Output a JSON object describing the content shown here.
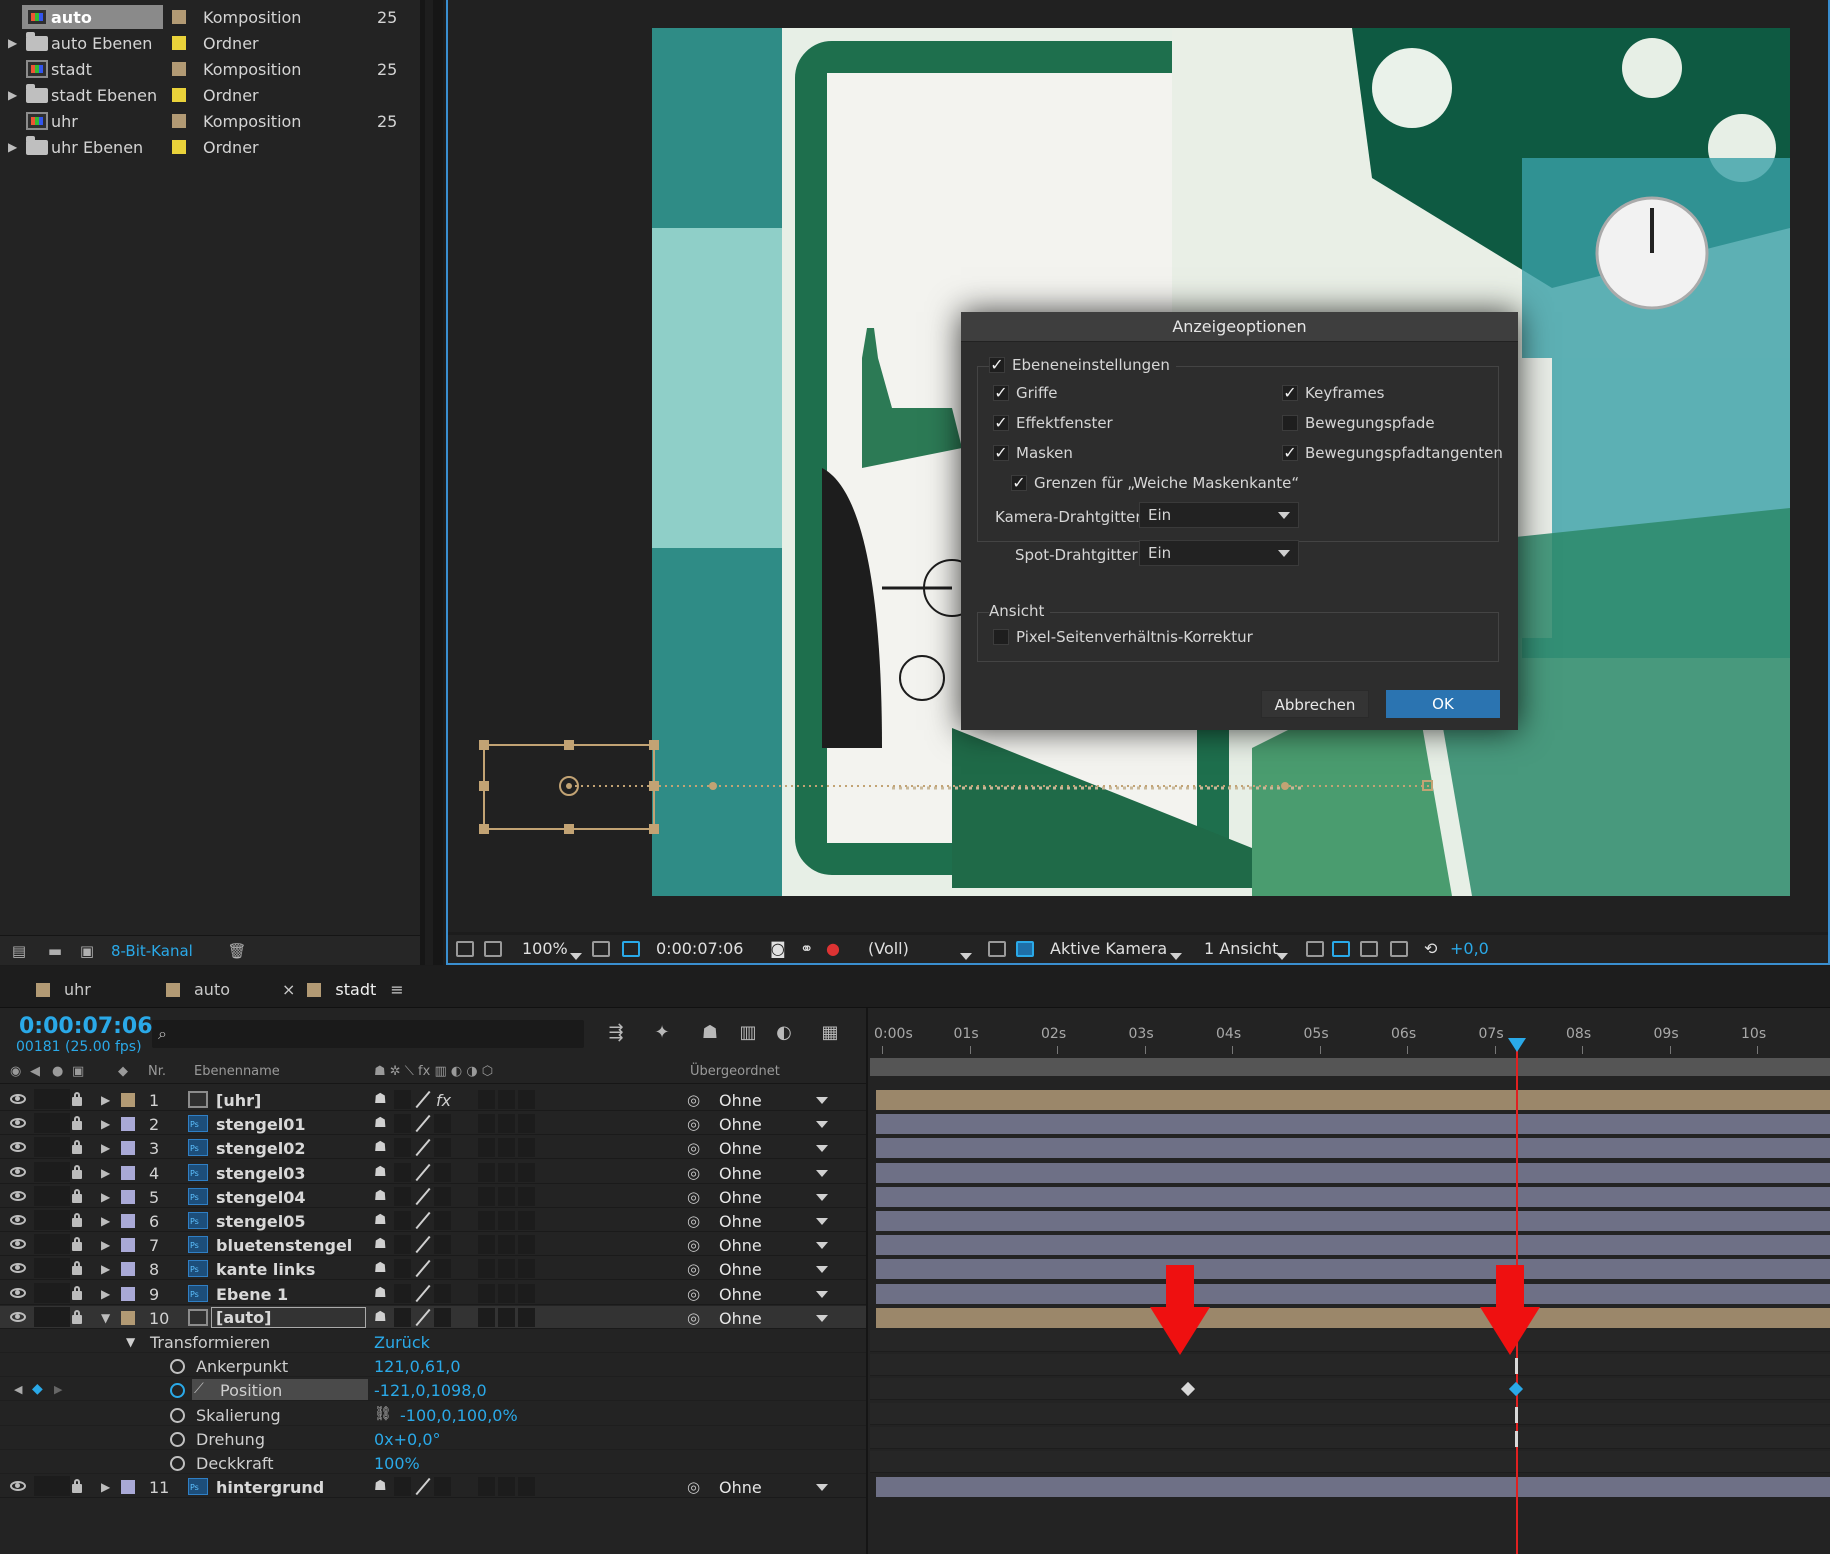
{
  "project": {
    "items": [
      {
        "name": "auto",
        "label_color": "#b29a74",
        "type": "Komposition",
        "frames": "25",
        "kind": "comp",
        "twirl": "",
        "selected": true
      },
      {
        "name": "auto Ebenen",
        "label_color": "#e9d23a",
        "type": "Ordner",
        "frames": "",
        "kind": "folder",
        "twirl": "▶"
      },
      {
        "name": "stadt",
        "label_color": "#b29a74",
        "type": "Komposition",
        "frames": "25",
        "kind": "comp",
        "twirl": ""
      },
      {
        "name": "stadt Ebenen",
        "label_color": "#e9d23a",
        "type": "Ordner",
        "frames": "",
        "kind": "folder",
        "twirl": "▶"
      },
      {
        "name": "uhr",
        "label_color": "#b29a74",
        "type": "Komposition",
        "frames": "25",
        "kind": "comp",
        "twirl": ""
      },
      {
        "name": "uhr Ebenen",
        "label_color": "#e9d23a",
        "type": "Ordner",
        "frames": "",
        "kind": "folder",
        "twirl": "▶"
      }
    ],
    "bit_depth": "8-Bit-Kanal"
  },
  "viewer": {
    "zoom": "100%",
    "timecode": "0:00:07:06",
    "resolution": "(Voll)",
    "camera": "Aktive Kamera",
    "views": "1 Ansicht",
    "exposure": "+0,0"
  },
  "dialog": {
    "title": "Anzeigeoptionen",
    "group1_label": "Ebeneneinstellungen",
    "griffe": "Griffe",
    "effektfenster": "Effektfenster",
    "masken": "Masken",
    "grenzen": "Grenzen für „Weiche Maskenkante“",
    "keyframes": "Keyframes",
    "bewegungspfade": "Bewegungspfade",
    "bewegungspfadtangenten": "Bewegungspfadtangenten",
    "kamera_label": "Kamera-Drahtgitter:",
    "kamera_value": "Ein",
    "spot_label": "Spot-Drahtgitter:",
    "spot_value": "Ein",
    "group2_label": "Ansicht",
    "pixel": "Pixel-Seitenverhältnis-Korrektur",
    "cancel": "Abbrechen",
    "ok": "OK"
  },
  "timeline": {
    "tabs": [
      {
        "label": "uhr",
        "color": "#b29a74"
      },
      {
        "label": "auto",
        "color": "#b29a74"
      },
      {
        "label": "stadt",
        "color": "#b29a74"
      }
    ],
    "close_glyph": "×",
    "menu_glyph": "≡",
    "timecode": "0:00:07:06",
    "fps": "00181 (25.00 fps)",
    "search_glyph": "⌕",
    "col_nr": "Nr.",
    "col_name": "Ebenenname",
    "col_parent": "Übergeordnet",
    "ruler": [
      "0:00s",
      "01s",
      "02s",
      "03s",
      "04s",
      "05s",
      "06s",
      "07s",
      "08s",
      "09s",
      "10s"
    ],
    "layers": [
      {
        "num": "1",
        "name": "[uhr]",
        "kind": "comp",
        "label_color": "#b29a74",
        "parent": "Ohne",
        "bar": "tan",
        "fx": "fx"
      },
      {
        "num": "2",
        "name": "stengel01",
        "kind": "ps",
        "label_color": "#a9a9d6",
        "parent": "Ohne",
        "bar": "lav",
        "fx": ""
      },
      {
        "num": "3",
        "name": "stengel02",
        "kind": "ps",
        "label_color": "#a9a9d6",
        "parent": "Ohne",
        "bar": "lav",
        "fx": ""
      },
      {
        "num": "4",
        "name": "stengel03",
        "kind": "ps",
        "label_color": "#a9a9d6",
        "parent": "Ohne",
        "bar": "lav",
        "fx": ""
      },
      {
        "num": "5",
        "name": "stengel04",
        "kind": "ps",
        "label_color": "#a9a9d6",
        "parent": "Ohne",
        "bar": "lav",
        "fx": ""
      },
      {
        "num": "6",
        "name": "stengel05",
        "kind": "ps",
        "label_color": "#a9a9d6",
        "parent": "Ohne",
        "bar": "lav",
        "fx": ""
      },
      {
        "num": "7",
        "name": "bluetenstengel",
        "kind": "ps",
        "label_color": "#a9a9d6",
        "parent": "Ohne",
        "bar": "lav",
        "fx": ""
      },
      {
        "num": "8",
        "name": "kante links",
        "kind": "ps",
        "label_color": "#a9a9d6",
        "parent": "Ohne",
        "bar": "lav",
        "fx": ""
      },
      {
        "num": "9",
        "name": "Ebene 1",
        "kind": "ps",
        "label_color": "#a9a9d6",
        "parent": "Ohne",
        "bar": "lav",
        "fx": ""
      },
      {
        "num": "10",
        "name": "[auto]",
        "kind": "comp",
        "label_color": "#b29a74",
        "parent": "Ohne",
        "bar": "tan",
        "fx": "",
        "selected": true
      }
    ],
    "transform": {
      "label": "Transformieren",
      "reset": "Zurück",
      "props": [
        {
          "name": "Ankerpunkt",
          "value": "121,0,61,0"
        },
        {
          "name": "Position",
          "value": "-121,0,1098,0"
        },
        {
          "name": "Skalierung",
          "value": "-100,0,100,0%"
        },
        {
          "name": "Drehung",
          "value": "0x+0,0°"
        },
        {
          "name": "Deckkraft",
          "value": "100%"
        }
      ]
    },
    "last_layer": {
      "num": "11",
      "name": "hintergrund",
      "kind": "ps",
      "label_color": "#a9a9d6",
      "parent": "Ohne"
    },
    "current_time_s": 7.24,
    "position_keyframes_s": [
      3.5,
      7.24
    ],
    "accent": "#2aa9e8",
    "cti_color": "#e02020",
    "arrow_color": "#ef1010"
  }
}
